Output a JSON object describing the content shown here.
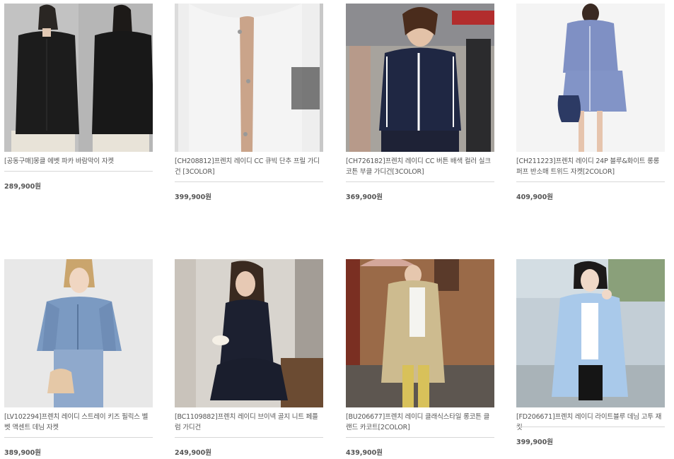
{
  "products": [
    {
      "name": "[공동구매]몽클 에벳 파카 바람막이 자켓",
      "price": "289,900원",
      "image": "moncler-black-parka-photo",
      "bg": "#bdbdbd"
    },
    {
      "name": "[CH208812]프렌치 레이디 CC 큐빅 단추 프릴 가디건 [3COLOR]",
      "price": "399,900원",
      "image": "white-lace-cardigan-photo",
      "bg": "#e9e9e9"
    },
    {
      "name": "[CH726182]프렌치 레이디 CC 버튼 배색 컬러 실크 코튼 부클 가디건[3COLOR]",
      "price": "369,900원",
      "image": "navy-boucle-cardigan-street-photo",
      "bg": "#9a958f"
    },
    {
      "name": "[CH211223]프렌치 레이디 24P 블루&화이트 롱롱 퍼프 반소매 트위드 자켓[2COLOR]",
      "price": "409,900원",
      "image": "blue-tweed-set-photo",
      "bg": "#f3f3f3"
    },
    {
      "name": "[LV102294]프렌치 레이디 스트레이 키즈 필릭스 벨벳 액센트 데님 자켓",
      "price": "389,900원",
      "image": "denim-jacket-photo",
      "bg": "#e6e6e6"
    },
    {
      "name": "[BC1109882]프렌치 레이디 브이넥 골지 니트 페플럼 가디건",
      "price": "249,900원",
      "image": "black-peplum-knit-photo",
      "bg": "#cfcac4"
    },
    {
      "name": "[BU206677]프렌치 레이디 클래식스타일 롱코튼 클랜드 카코트[2COLOR]",
      "price": "439,900원",
      "image": "beige-trench-coat-photo",
      "bg": "#8e5a3a"
    },
    {
      "name": "[FD206671]프렌치 레이디 라이트블루 데님 고투 재킷",
      "price": "399,900원",
      "image": "light-blue-denim-shirt-photo",
      "bg": "#b9c6cf"
    }
  ]
}
